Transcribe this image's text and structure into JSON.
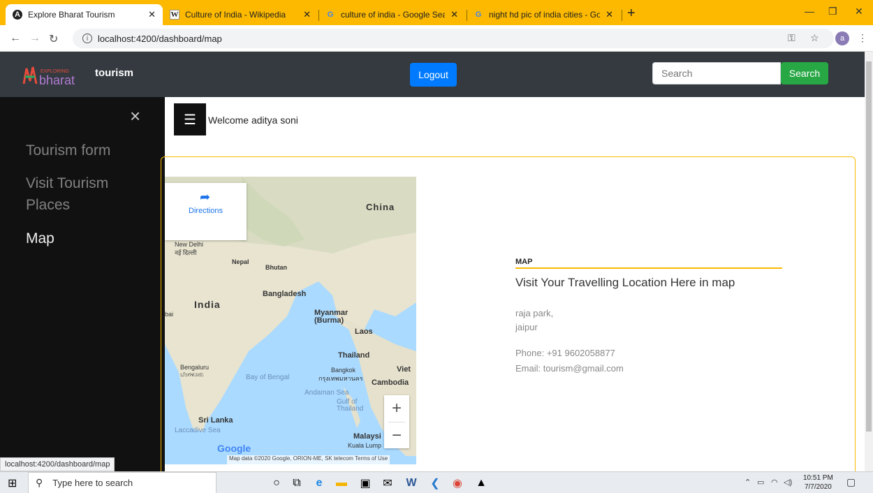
{
  "browser": {
    "tabs": [
      {
        "title": "Explore Bharat Tourism",
        "icon": "angular-icon",
        "active": true
      },
      {
        "title": "Culture of India - Wikipedia",
        "icon": "wikipedia-icon",
        "active": false
      },
      {
        "title": "culture of india - Google Search",
        "icon": "google-icon",
        "active": false
      },
      {
        "title": "night hd pic of india cities - Goo",
        "icon": "google-icon",
        "active": false
      }
    ],
    "url": "localhost:4200/dashboard/map",
    "avatar_letter": "a"
  },
  "navbar": {
    "brand_logo_text": "EXPLORING bharat",
    "brand_text": "tourism",
    "logout_label": "Logout",
    "search_placeholder": "Search",
    "search_button_label": "Search"
  },
  "sidebar": {
    "close_symbol": "×",
    "items": [
      {
        "label": "Tourism form",
        "active": false
      },
      {
        "label": "Visit Tourism Places",
        "active": false
      },
      {
        "label": "Map",
        "active": true
      }
    ]
  },
  "main": {
    "menu_symbol": "☰",
    "welcome_text": "Welcome aditya soni"
  },
  "map": {
    "directions_label": "Directions",
    "labels": [
      "China",
      "New Delhi",
      "नई दिल्ली",
      "Nepal",
      "Bhutan",
      "India",
      "Bangladesh",
      "Myanmar (Burma)",
      "Laos",
      "Thailand",
      "Bengaluru",
      "ಬೆಂಗಳೂರು",
      "Bay of Bengal",
      "Bangkok",
      "กรุงเทพมหานคร",
      "Viet",
      "Cambodia",
      "Andaman Sea",
      "Gulf of Thailand",
      "Sri Lanka",
      "Laccadive Sea",
      "Malaysi",
      "Kuala Lump",
      "bai"
    ],
    "google_logo": "Google",
    "attribution": "Map data ©2020 Google, ORION-ME, SK telecom   Terms of Use"
  },
  "info": {
    "title": "MAP",
    "heading": "Visit Your Travelling Location Here in map",
    "address_line1": "raja park,",
    "address_line2": "jaipur",
    "phone": "Phone: +91 9602058877",
    "email": "Email: tourism@gmail.com"
  },
  "status_bar_url": "localhost:4200/dashboard/map",
  "taskbar": {
    "search_placeholder": "Type here to search",
    "time": "10:51 PM",
    "date": "7/7/2020"
  }
}
